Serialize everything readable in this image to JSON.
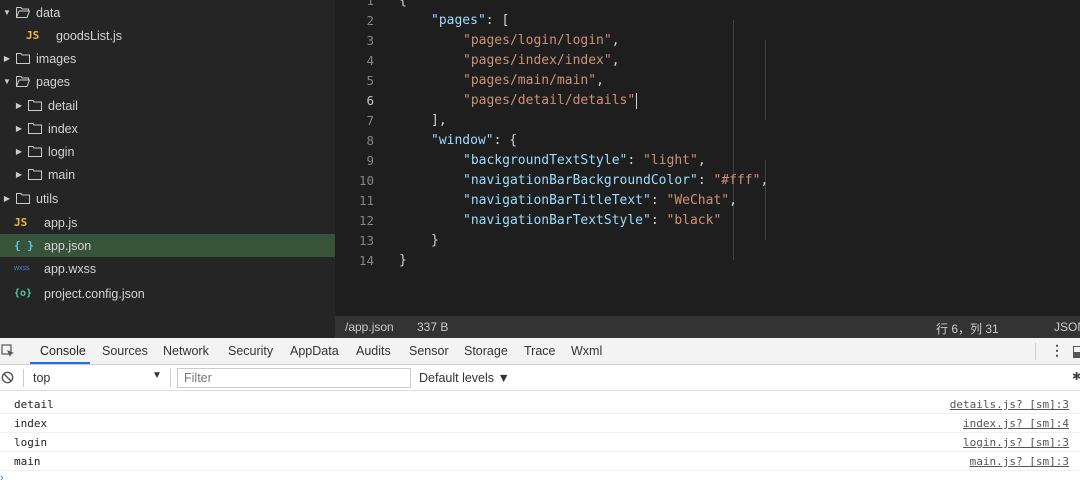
{
  "sidebar": {
    "items": [
      {
        "label": "data",
        "kind": "folder",
        "open": true
      },
      {
        "label": "goodsList.js",
        "kind": "js",
        "badge": "JS"
      },
      {
        "label": "images",
        "kind": "folder",
        "open": false
      },
      {
        "label": "pages",
        "kind": "folder",
        "open": true
      },
      {
        "label": "detail",
        "kind": "folder",
        "open": false
      },
      {
        "label": "index",
        "kind": "folder",
        "open": false
      },
      {
        "label": "login",
        "kind": "folder",
        "open": false
      },
      {
        "label": "main",
        "kind": "folder",
        "open": false
      },
      {
        "label": "utils",
        "kind": "folder",
        "open": false
      },
      {
        "label": "app.js",
        "kind": "js",
        "badge": "JS"
      },
      {
        "label": "app.json",
        "kind": "json",
        "badge": "{ }",
        "selected": true
      },
      {
        "label": "app.wxss",
        "kind": "wxss",
        "badge": "wxss"
      },
      {
        "label": "project.config.json",
        "kind": "cfg",
        "badge": "{o}"
      }
    ]
  },
  "editor": {
    "line_numbers": [
      "1",
      "2",
      "3",
      "4",
      "5",
      "6",
      "7",
      "8",
      "9",
      "10",
      "11",
      "12",
      "13",
      "14"
    ],
    "active_line": "6",
    "lines": [
      {
        "k": "",
        "sep": "",
        "s": "",
        "end": "{"
      },
      {
        "k": "\"pages\"",
        "sep": ": [",
        "s": "",
        "end": ""
      },
      {
        "k": "",
        "sep": "",
        "s": "\"pages/login/login\"",
        "end": ","
      },
      {
        "k": "",
        "sep": "",
        "s": "\"pages/index/index\"",
        "end": ","
      },
      {
        "k": "",
        "sep": "",
        "s": "\"pages/main/main\"",
        "end": ","
      },
      {
        "k": "",
        "sep": "",
        "s": "\"pages/detail/details\"",
        "end": ""
      },
      {
        "k": "",
        "sep": "",
        "s": "",
        "end": "],"
      },
      {
        "k": "\"window\"",
        "sep": ": {",
        "s": "",
        "end": ""
      },
      {
        "k": "\"backgroundTextStyle\"",
        "sep": ": ",
        "s": "\"light\"",
        "end": ","
      },
      {
        "k": "\"navigationBarBackgroundColor\"",
        "sep": ": ",
        "s": "\"#fff\"",
        "end": ","
      },
      {
        "k": "\"navigationBarTitleText\"",
        "sep": ": ",
        "s": "\"WeChat\"",
        "end": ","
      },
      {
        "k": "\"navigationBarTextStyle\"",
        "sep": ": ",
        "s": "\"black\"",
        "end": ""
      },
      {
        "k": "",
        "sep": "",
        "s": "",
        "end": "}"
      },
      {
        "k": "",
        "sep": "",
        "s": "",
        "end": "}"
      }
    ]
  },
  "statusbar": {
    "path": "/app.json",
    "size": "337 B",
    "position": "行 6，列 31",
    "language": "JSON"
  },
  "devtools": {
    "tabs": [
      "Console",
      "Sources",
      "Network",
      "Security",
      "AppData",
      "Audits",
      "Sensor",
      "Storage",
      "Trace",
      "Wxml"
    ],
    "active_tab": "Console",
    "context": "top",
    "filter_placeholder": "Filter",
    "levels": "Default levels ▼"
  },
  "console": {
    "logs": [
      {
        "message": "detail",
        "source": "details.js? [sm]:3"
      },
      {
        "message": "index",
        "source": "index.js? [sm]:4"
      },
      {
        "message": "login",
        "source": "login.js? [sm]:3"
      },
      {
        "message": "main",
        "source": "main.js? [sm]:3"
      }
    ]
  },
  "colors": {
    "sidebar_bg": "#252526",
    "editor_bg": "#1e1e1e",
    "selected_row": "#37533a",
    "key": "#9cdcfe",
    "string": "#ce9178",
    "tab_underline": "#1a73e8"
  }
}
